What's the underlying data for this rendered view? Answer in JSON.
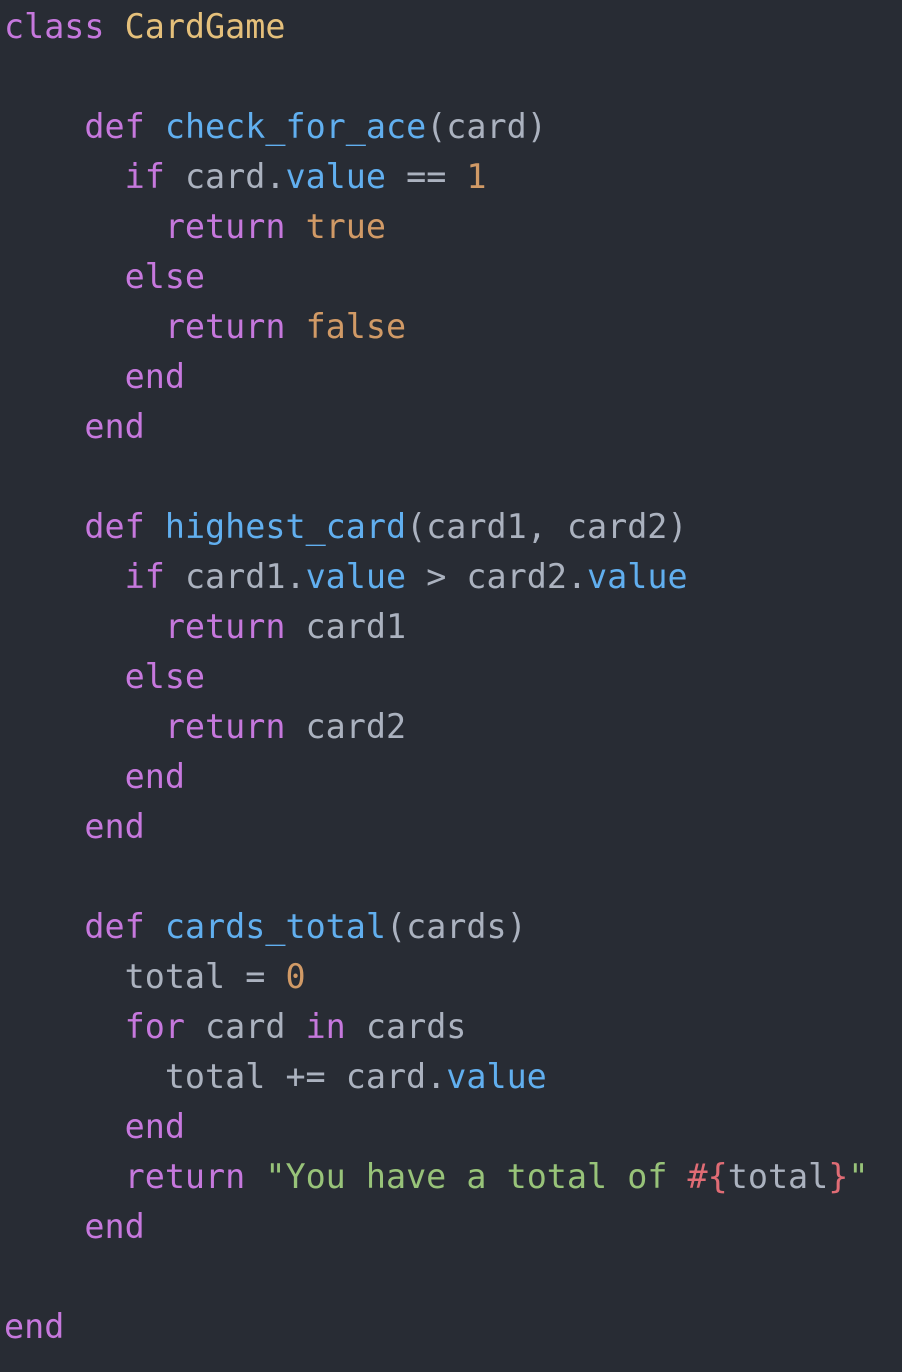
{
  "colors": {
    "background": "#282c34",
    "keyword": "#c678dd",
    "class_name": "#e5c07b",
    "function": "#61afef",
    "property": "#61afef",
    "plain": "#abb2bf",
    "number": "#d19a66",
    "boolean": "#d19a66",
    "string": "#98c379",
    "interpolation": "#e06c75"
  },
  "code": {
    "language": "ruby",
    "lines": [
      [
        [
          "keyword",
          "class"
        ],
        [
          "plain",
          " "
        ],
        [
          "classname",
          "CardGame"
        ]
      ],
      [],
      [
        [
          "plain",
          "    "
        ],
        [
          "keyword",
          "def"
        ],
        [
          "plain",
          " "
        ],
        [
          "func",
          "check_for_ace"
        ],
        [
          "plain",
          "(card)"
        ]
      ],
      [
        [
          "plain",
          "      "
        ],
        [
          "keyword",
          "if"
        ],
        [
          "plain",
          " card."
        ],
        [
          "prop",
          "value"
        ],
        [
          "plain",
          " == "
        ],
        [
          "number",
          "1"
        ]
      ],
      [
        [
          "plain",
          "        "
        ],
        [
          "keyword",
          "return"
        ],
        [
          "plain",
          " "
        ],
        [
          "bool",
          "true"
        ]
      ],
      [
        [
          "plain",
          "      "
        ],
        [
          "keyword",
          "else"
        ]
      ],
      [
        [
          "plain",
          "        "
        ],
        [
          "keyword",
          "return"
        ],
        [
          "plain",
          " "
        ],
        [
          "bool",
          "false"
        ]
      ],
      [
        [
          "plain",
          "      "
        ],
        [
          "keyword",
          "end"
        ]
      ],
      [
        [
          "plain",
          "    "
        ],
        [
          "keyword",
          "end"
        ]
      ],
      [],
      [
        [
          "plain",
          "    "
        ],
        [
          "keyword",
          "def"
        ],
        [
          "plain",
          " "
        ],
        [
          "func",
          "highest_card"
        ],
        [
          "plain",
          "(card1, card2)"
        ]
      ],
      [
        [
          "plain",
          "      "
        ],
        [
          "keyword",
          "if"
        ],
        [
          "plain",
          " card1."
        ],
        [
          "prop",
          "value"
        ],
        [
          "plain",
          " > card2."
        ],
        [
          "prop",
          "value"
        ]
      ],
      [
        [
          "plain",
          "        "
        ],
        [
          "keyword",
          "return"
        ],
        [
          "plain",
          " card1"
        ]
      ],
      [
        [
          "plain",
          "      "
        ],
        [
          "keyword",
          "else"
        ]
      ],
      [
        [
          "plain",
          "        "
        ],
        [
          "keyword",
          "return"
        ],
        [
          "plain",
          " card2"
        ]
      ],
      [
        [
          "plain",
          "      "
        ],
        [
          "keyword",
          "end"
        ]
      ],
      [
        [
          "plain",
          "    "
        ],
        [
          "keyword",
          "end"
        ]
      ],
      [],
      [
        [
          "plain",
          "    "
        ],
        [
          "keyword",
          "def"
        ],
        [
          "plain",
          " "
        ],
        [
          "func",
          "cards_total"
        ],
        [
          "plain",
          "(cards)"
        ]
      ],
      [
        [
          "plain",
          "      total = "
        ],
        [
          "number",
          "0"
        ]
      ],
      [
        [
          "plain",
          "      "
        ],
        [
          "keyword",
          "for"
        ],
        [
          "plain",
          " card "
        ],
        [
          "keyword",
          "in"
        ],
        [
          "plain",
          " cards"
        ]
      ],
      [
        [
          "plain",
          "        total += card."
        ],
        [
          "prop",
          "value"
        ]
      ],
      [
        [
          "plain",
          "      "
        ],
        [
          "keyword",
          "end"
        ]
      ],
      [
        [
          "plain",
          "      "
        ],
        [
          "keyword",
          "return"
        ],
        [
          "plain",
          " "
        ],
        [
          "string",
          "\"You have a total of "
        ],
        [
          "interp",
          "#{"
        ],
        [
          "plain",
          "total"
        ],
        [
          "interp",
          "}"
        ],
        [
          "string",
          "\""
        ]
      ],
      [
        [
          "plain",
          "    "
        ],
        [
          "keyword",
          "end"
        ]
      ],
      [],
      [
        [
          "keyword",
          "end"
        ]
      ]
    ]
  }
}
